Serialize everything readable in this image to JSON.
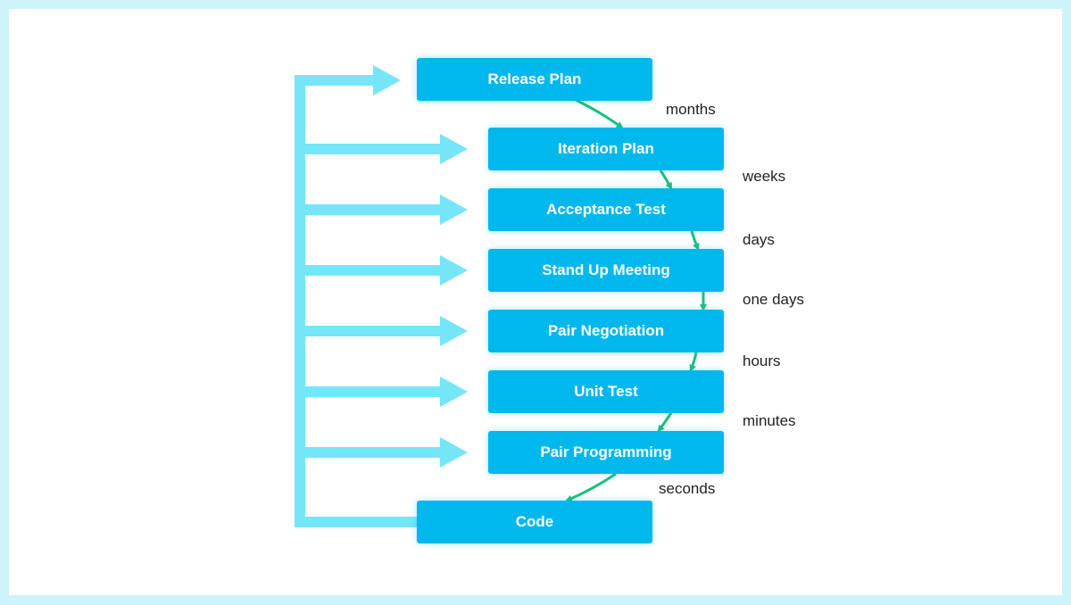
{
  "colors": {
    "box": "#00b8ec",
    "feedback": "#74e6f8",
    "flow": "#1abf7e",
    "frame": "#cdf3fb"
  },
  "steps": [
    {
      "label": "Release Plan"
    },
    {
      "label": "Iteration Plan"
    },
    {
      "label": "Acceptance Test"
    },
    {
      "label": "Stand Up Meeting"
    },
    {
      "label": "Pair Negotiation"
    },
    {
      "label": "Unit Test"
    },
    {
      "label": "Pair Programming"
    },
    {
      "label": "Code"
    }
  ],
  "intervals": [
    "months",
    "weeks",
    "days",
    "one days",
    "hours",
    "minutes",
    "seconds"
  ]
}
